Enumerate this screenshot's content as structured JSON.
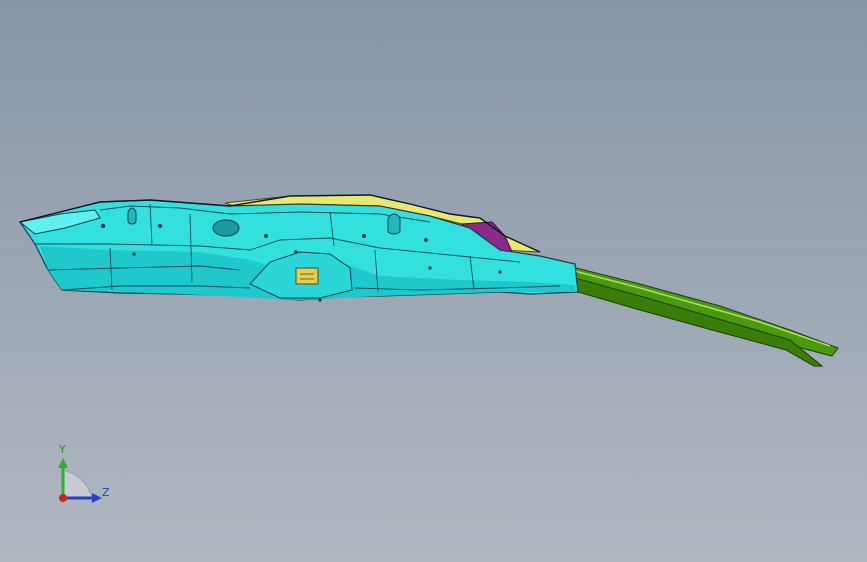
{
  "viewport": {
    "background_top": "#8896a9",
    "background_bottom": "#b1b8c0"
  },
  "model": {
    "part_colors": {
      "main_body": "#33e0e0",
      "body_shade": "#1fc8cc",
      "top_trim": "#e8e870",
      "accent_purple": "#8a2a8a",
      "rail_green": "#4a9a10",
      "rail_dark": "#2e6a08",
      "edge_lines": "#1a3a4a"
    },
    "icons": [
      "bracket-icon"
    ]
  },
  "triad": {
    "y_label": "Y",
    "z_label": "Z",
    "y_color": "#2fb02f",
    "z_color": "#2a40d0",
    "x_color": "#d02020"
  }
}
